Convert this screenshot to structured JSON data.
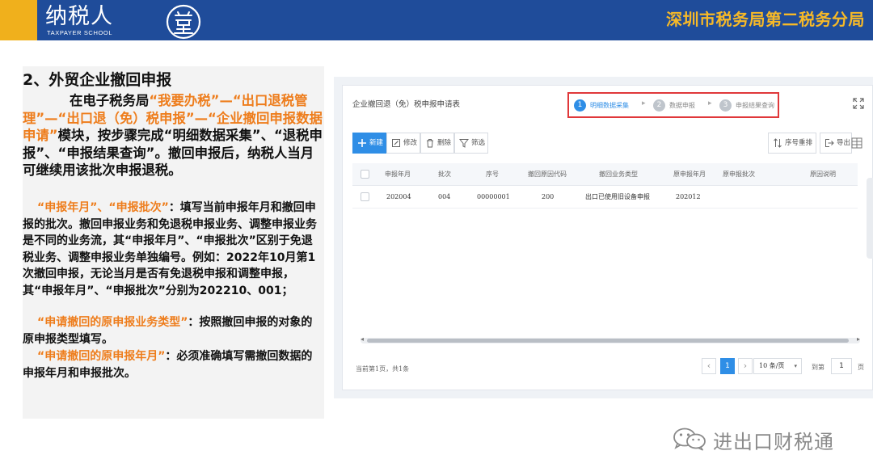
{
  "header": {
    "brand_name": "纳税人",
    "brand_sub": "TAXPAYER SCHOOL",
    "seal_char": "学堂",
    "title": "深圳市税务局第二税务分局",
    "bg_color": "#1f4c9a",
    "accent_color": "#f0b01c"
  },
  "left": {
    "section_title": "2、外贸企业撤回申报",
    "p1_a": "在电子税务局",
    "p1_hl1": "“我要办税”—“出口退税管理”—“出口退（免）税申报”—“企业撤回申报数据申请”",
    "p1_b": "模块，按步骤完成“明细数据采集”、“退税申报”、“申报结果查询”。撤回申报后，纳税人当月可继续用该批次申报退税。",
    "p2_hl": "“申报年月”、“申报批次”",
    "p2_text": "：填写当前申报年月和撤回申报的批次。撤回申报业务和免退税申报业务、调整申报业务是不同的业务流，其“申报年月”、“申报批次”区别于免退税业务、调整申报业务单独编号。例如：2022年10月第1次撤回申报，无论当月是否有免退税申报和调整申报，其“申报年月”、“申报批次”分别为202210、001；",
    "p3_hl": "“申请撤回的原申报业务类型”",
    "p3_text": "：按照撤回申报的对象的原申报类型填写。",
    "p4_hl": "“申请撤回的原申报年月”",
    "p4_text": "：必须准确填写需撤回数据的申报年月和申报批次。",
    "highlight_color": "#ee7d1c"
  },
  "app": {
    "title": "企业撤回退（免）税申报申请表",
    "steps": [
      {
        "num": "1",
        "label": "明细数据采集",
        "state": "active"
      },
      {
        "num": "2",
        "label": "数据申报",
        "state": "inactive"
      },
      {
        "num": "3",
        "label": "申报结果查询",
        "state": "inactive"
      }
    ],
    "toolbar": {
      "new": "新建",
      "edit": "修改",
      "delete": "删除",
      "filter": "筛选",
      "reorder": "序号重排",
      "export": "导出"
    },
    "table": {
      "headers": [
        "申报年月",
        "批次",
        "序号",
        "撤回原因代码",
        "撤回业务类型",
        "原申报年月",
        "原申报批次",
        "原因说明"
      ],
      "rows": [
        [
          "202004",
          "004",
          "00000001",
          "200",
          "出口已使用旧设备申报",
          "202012",
          "",
          ""
        ]
      ]
    },
    "footer": {
      "summary": "当前第1页，共1条",
      "current_page": "1",
      "page_size": "10 条/页",
      "goto_label": "到第",
      "goto_value": "1",
      "goto_unit": "页"
    },
    "accent_color": "#2f8ee6",
    "step_border_color": "#e0383a"
  },
  "watermark": {
    "text": "进出口财税通"
  }
}
